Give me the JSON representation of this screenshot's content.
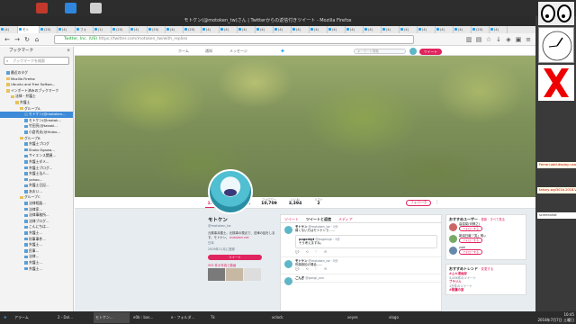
{
  "window": {
    "title": "モトケン(@motoken_tw)さん | Twitterからの返信付きツイート - Mozilla Firefox"
  },
  "tabs": [
    "(4)",
    "モト",
    "(20)",
    "(4)",
    "フォ",
    "(1)",
    "(20)",
    "(4)",
    "(20)",
    "(4)",
    "(20)",
    "(4)",
    "(4)",
    "(4)",
    "(4)",
    "(4)",
    "(4)",
    "(4)",
    "(4)",
    "(4)",
    "(4)",
    "(4)",
    "(4)",
    "(4)",
    "(4)",
    "(4)",
    "(20)",
    "(4)"
  ],
  "url": {
    "security": "Twitter, Inc. (US)",
    "address": "https://twitter.com/motoken_tw/with_replies"
  },
  "sidebar": {
    "title": "ブックマーク",
    "search_placeholder": "ブックマークを検索",
    "items": [
      "最近のタグ",
      "Mozilla Firefox",
      "Ubuntu and Free Softwa...",
      "インポート済みのブックマーク",
      "法律・弁護士",
      "弁護士",
      "グループA",
      "モトケン(@motoken...",
      "モトケン(@motok...",
      "竹田亮(@takaki...",
      "小倉秀夫(@Hideo...",
      "グループB",
      "弁護士ブログ",
      "Shoko Egawa...",
      "サイエンス関連...",
      "弁護士ダメ...",
      "弁護士ブログ...",
      "弁護士法人...",
      "yahoo...",
      "弁護士日記...",
      "あおい...",
      "グループC",
      "法律相談...",
      "法律家...",
      "法律事務所...",
      "法律ブログ...",
      "こんにちは...",
      "弁護士...",
      "刑事事件...",
      "弁護士...",
      "民事...",
      "法律...",
      "弁護士...",
      "弁護士..."
    ]
  },
  "twitter": {
    "nav": [
      "ホーム",
      "通知",
      "メッセージ"
    ],
    "search_placeholder": "キーワード検索",
    "tweet_button": "ツイート",
    "stats": [
      {
        "label": "ツイート",
        "value": "107,089"
      },
      {
        "label": "フォロー",
        "value": "1,791"
      },
      {
        "label": "フォロワー",
        "value": "10,709"
      },
      {
        "label": "いいね",
        "value": "3,394"
      },
      {
        "label": "リスト",
        "value": "2"
      }
    ],
    "follow_button": "フォロー中",
    "profile": {
      "name": "モトケン",
      "handle": "@motoken_tw",
      "bio": "元検事弁護士。元検事の視点で、法律の話をします。モトケン。",
      "link": "motoken.net",
      "location": "日本",
      "joined": "2009年11月に登録",
      "tweet_to": "ツイート",
      "media": "555 件の写真と動画"
    },
    "timeline_tabs": [
      "ツイート",
      "ツイートと返信",
      "メディア"
    ],
    "tweets": [
      {
        "name": "モトケン",
        "handle": "@motoken_tw · 1分",
        "text": "痛くない方はモトケンで……"
      },
      {
        "name": "pugonigt",
        "handle": "@pugonigt · 1分",
        "text": "そう考えますね。"
      },
      {
        "name": "モトケン",
        "handle": "@motoken_tw · 5分",
        "text": "刑事訴訟の場合……"
      },
      {
        "name": "ごんぎ",
        "handle": "@gongi_xxx",
        "text": ""
      }
    ],
    "who_to_follow": {
      "title": "おすすめユーザー",
      "refresh": "· 更新 · すべて見る",
      "users": [
        {
          "name": "高遠菜(河鍋之)",
          "btn": "フォローする"
        },
        {
          "name": "新潟日報「笑」唯ぃ",
          "btn": "フォローする"
        },
        {
          "name": "yuki",
          "btn": "フォローする"
        }
      ]
    },
    "trends": {
      "title": "おすすめトレンド",
      "change": "· 変更する",
      "items": [
        {
          "t": "#ムキ漫画部",
          "c": "3,006件のツイート"
        },
        {
          "t": "ブラジル",
          "c": "1万件のツイート"
        },
        {
          "t": "#歌鷹の宴",
          "c": ""
        }
      ]
    }
  },
  "desktop": {
    "windows": [
      "Ferrari-add-deploy-unag.f",
      "takory-wgi301b.2018.V",
      "screenshot"
    ]
  },
  "taskbar": {
    "items": [
      "アラーム",
      "2 - Dol...",
      "モトケン...",
      "e0b : bas...",
      "e - フォルダ...",
      "Tk",
      "xclock",
      "xeyes",
      "xlogo"
    ],
    "time": "10:45",
    "date": "2018年7月7日 土曜日"
  }
}
